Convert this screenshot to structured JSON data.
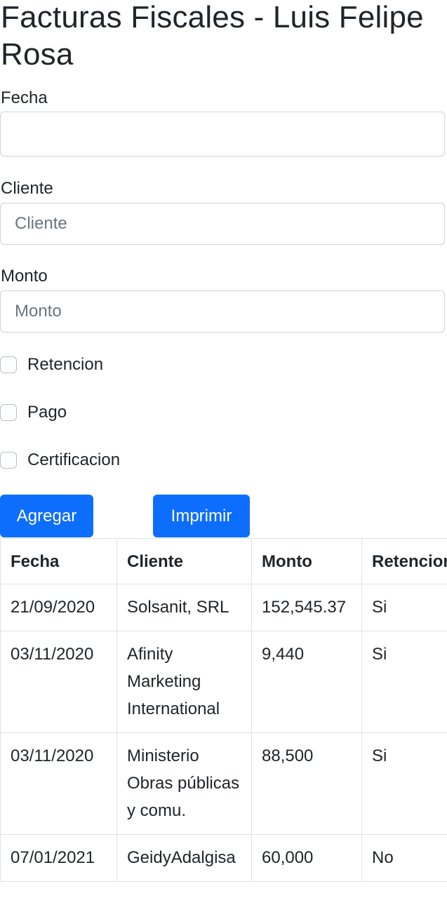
{
  "page": {
    "title": "Facturas Fiscales - Luis Felipe Rosa"
  },
  "form": {
    "fecha_label": "Fecha",
    "fecha_value": "",
    "cliente_label": "Cliente",
    "cliente_placeholder": "Cliente",
    "monto_label": "Monto",
    "monto_placeholder": "Monto",
    "checkboxes": [
      {
        "label": "Retencion",
        "checked": false
      },
      {
        "label": "Pago",
        "checked": false
      },
      {
        "label": "Certificacion",
        "checked": false
      }
    ],
    "add_button": "Agregar",
    "print_button": "Imprimir"
  },
  "table": {
    "headers": [
      "Fecha",
      "Cliente",
      "Monto",
      "Retencion"
    ],
    "rows": [
      [
        "21/09/2020",
        "Solsanit, SRL",
        "152,545.37",
        "Si"
      ],
      [
        "03/11/2020",
        "Afinity Marketing International",
        "9,440",
        "Si"
      ],
      [
        "03/11/2020",
        "Ministerio Obras públicas y comu.",
        "88,500",
        "Si"
      ],
      [
        "07/01/2021",
        "GeidyAdalgisa",
        "60,000",
        "No"
      ]
    ]
  },
  "colors": {
    "primary": "#0d6efd",
    "border": "#ced4da",
    "placeholder": "#6c757d"
  }
}
